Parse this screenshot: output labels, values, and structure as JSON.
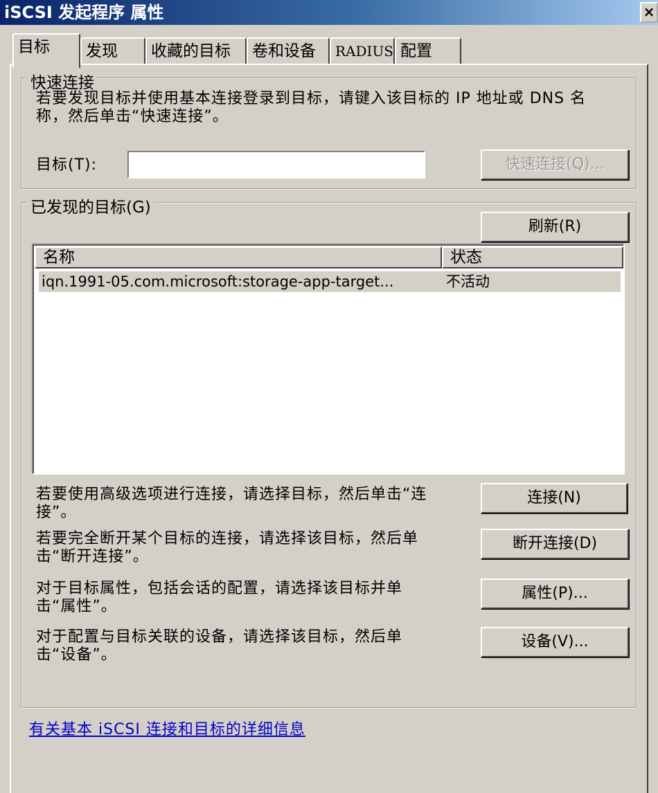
{
  "window": {
    "title": "iSCSI 发起程序 属性",
    "close_label": "×"
  },
  "tabs": [
    {
      "label": "目标",
      "active": true
    },
    {
      "label": "发现",
      "active": false
    },
    {
      "label": "收藏的目标",
      "active": false
    },
    {
      "label": "卷和设备",
      "active": false
    },
    {
      "label": "RADIUS",
      "active": false
    },
    {
      "label": "配置",
      "active": false
    }
  ],
  "quick_connect": {
    "group_label": "快速连接",
    "description": "若要发现目标并使用基本连接登录到目标，请键入该目标的 IP 地址或 DNS 名称，然后单击“快速连接”。",
    "target_label": "目标(T):",
    "target_value": "",
    "button_label": "快速连接(Q)...",
    "button_enabled": false
  },
  "discovered": {
    "group_label": "已发现的目标(G)",
    "refresh_label": "刷新(R)",
    "columns": [
      "名称",
      "状态"
    ],
    "rows": [
      {
        "name": "iqn.1991-05.com.microsoft:storage-app-target...",
        "status": "不活动"
      }
    ]
  },
  "actions": [
    {
      "description": "若要使用高级选项进行连接，请选择目标，然后单击“连接”。",
      "button": "连接(N)"
    },
    {
      "description": "若要完全断开某个目标的连接，请选择该目标，然后单击“断开连接”。",
      "button": "断开连接(D)"
    },
    {
      "description": "对于目标属性，包括会话的配置，请选择该目标并单击“属性”。",
      "button": "属性(P)..."
    },
    {
      "description": "对于配置与目标关联的设备，请选择该目标，然后单击“设备”。",
      "button": "设备(V)..."
    }
  ],
  "help_link": "有关基本 iSCSI 连接和目标的详细信息",
  "colors": {
    "dialog_bg": "#d4d0c8",
    "title_gradient_start": "#0a246a",
    "link": "#0000cc"
  }
}
